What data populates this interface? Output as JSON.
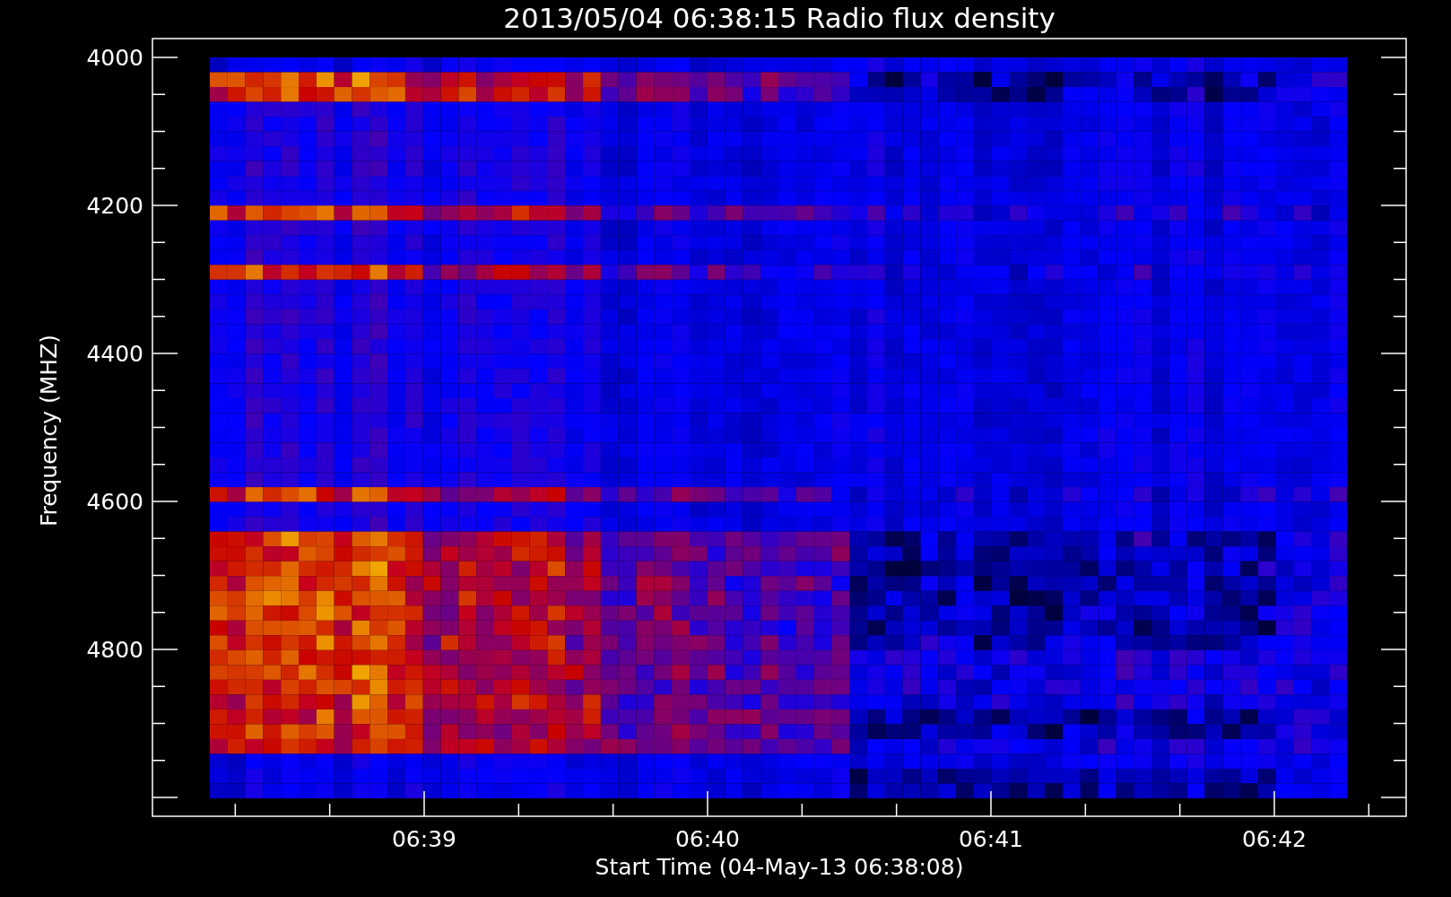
{
  "title": "2013/05/04 06:38:15 Radio flux density",
  "y_axis": {
    "label": "Frequency (MHZ)",
    "ticks": [
      "4000",
      "4200",
      "4400",
      "4600",
      "4800"
    ]
  },
  "x_axis": {
    "label": "Start Time (04-May-13 06:38:08)",
    "ticks": [
      "06:39",
      "06:40",
      "06:41",
      "06:42"
    ]
  }
}
